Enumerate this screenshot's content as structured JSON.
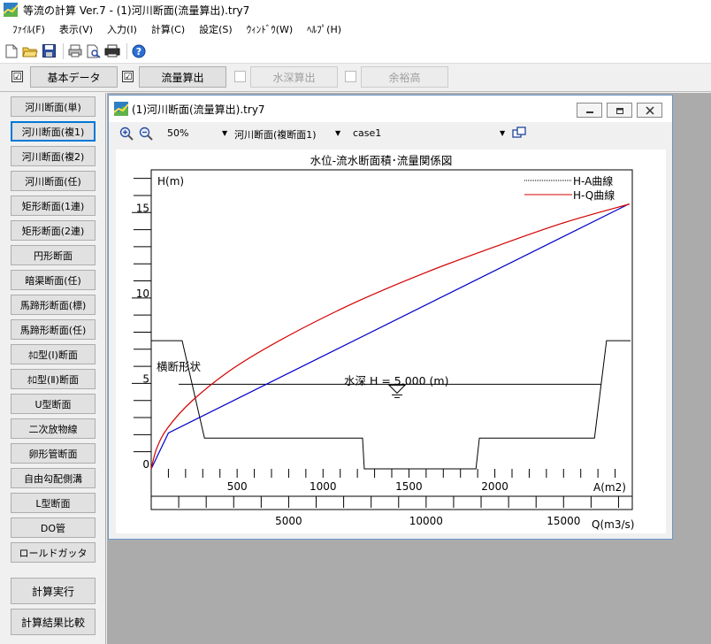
{
  "window": {
    "title": "等流の計算 Ver.7 - (1)河川断面(流量算出).try7",
    "app_icon": "app-graph-icon"
  },
  "menu": [
    "ﾌｧｲﾙ(F)",
    "表示(V)",
    "入力(I)",
    "計算(C)",
    "設定(S)",
    "ｳｨﾝﾄﾞｳ(W)",
    "ﾍﾙﾌﾟ(H)"
  ],
  "toolbar": {
    "icons": [
      "new-file-icon",
      "open-folder-icon",
      "save-icon",
      "print-icon",
      "print-preview-icon",
      "printer-setup-icon",
      "help-icon"
    ]
  },
  "modes": {
    "basic": {
      "checked": true,
      "label": "基本データ"
    },
    "flow": {
      "checked": true,
      "label": "流量算出"
    },
    "depth": {
      "checked": false,
      "label": "水深算出"
    },
    "freeboard": {
      "checked": false,
      "label": "余裕高"
    },
    "check_mark": "☑"
  },
  "sidebar": {
    "items": [
      "河川断面(単)",
      "河川断面(複1)",
      "河川断面(複2)",
      "河川断面(任)",
      "矩形断面(1連)",
      "矩形断面(2連)",
      "円形断面",
      "暗渠断面(任)",
      "馬蹄形断面(標)",
      "馬蹄形断面(任)",
      "ﾎﾛ型(Ⅰ)断面",
      "ﾎﾛ型(Ⅱ)断面",
      "U型断面",
      "二次放物線",
      "卵形管断面",
      "自由勾配側溝",
      "L型断面",
      "DO管",
      "ロールドガッタ"
    ],
    "active_index": 1,
    "run": "計算実行",
    "compare": "計算結果比較"
  },
  "child": {
    "title": "(1)河川断面(流量算出).try7",
    "zoom": "50%",
    "section": "河川断面(複断面1)",
    "case": "case1"
  },
  "chart_data": {
    "type": "line",
    "title": "水位-流水断面積･流量関係図",
    "ylabel": "H(m)",
    "xlabel_area": "A(m2)",
    "xlabel_q": "Q(m3/s)",
    "ylim": [
      0,
      17.5
    ],
    "area_ticks": [
      "500",
      "1000",
      "1500",
      "2000"
    ],
    "q_ticks": [
      "5000",
      "10000",
      "15000"
    ],
    "y_ticks": [
      "0",
      "5",
      "10",
      "15"
    ],
    "area_range": [
      0,
      2800
    ],
    "q_range": [
      0,
      17500
    ],
    "legend": [
      "H-A曲線",
      "H-Q曲線"
    ],
    "series": [
      {
        "name": "H-A曲線",
        "color": "#0000c8",
        "x_unit": "A(m2)",
        "points": [
          [
            0,
            0
          ],
          [
            100,
            2.1
          ],
          [
            2780,
            15.5
          ]
        ]
      },
      {
        "name": "H-Q曲線",
        "color": "#d40000",
        "x_unit": "Q(m3/s)",
        "points": [
          [
            0,
            0
          ],
          [
            200,
            1.2
          ],
          [
            600,
            2.4
          ],
          [
            1500,
            4.0
          ],
          [
            3000,
            5.9
          ],
          [
            5000,
            7.8
          ],
          [
            7500,
            9.8
          ],
          [
            10000,
            11.5
          ],
          [
            12500,
            13.0
          ],
          [
            15000,
            14.4
          ],
          [
            17400,
            15.5
          ]
        ]
      }
    ],
    "section_label": "横断形状",
    "section_points": [
      [
        0,
        7.5
      ],
      [
        180,
        7.5
      ],
      [
        310,
        1.8
      ],
      [
        1230,
        1.8
      ],
      [
        1240,
        0
      ],
      [
        1890,
        0
      ],
      [
        1910,
        1.8
      ],
      [
        2580,
        1.8
      ],
      [
        2650,
        7.5
      ],
      [
        2790,
        7.5
      ]
    ],
    "water_label": "水深 H = 5.000 (m)",
    "water_level": 4.95
  }
}
